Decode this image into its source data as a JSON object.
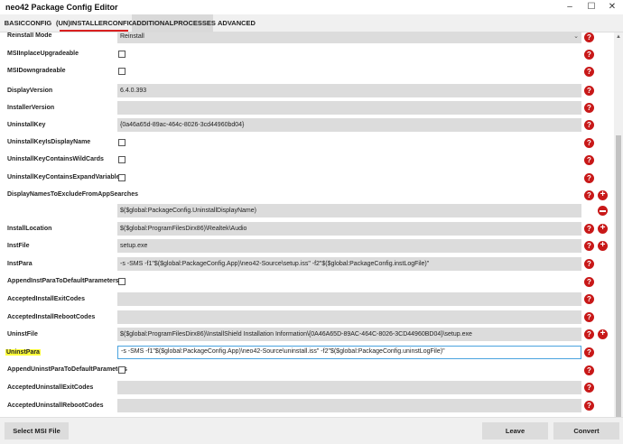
{
  "window": {
    "title": "neo42 Package Config Editor",
    "minimize": "–",
    "maximize": "☐",
    "close": "✕"
  },
  "tabs": [
    {
      "label": "BASICCONFIG"
    },
    {
      "label": "(UN)INSTALLERCONFIG"
    },
    {
      "label": "ADDITIONALPROCESSES"
    },
    {
      "label": "ADVANCED"
    }
  ],
  "icons": {
    "help": "?",
    "add": "+"
  },
  "fields": {
    "reinstall_mode": {
      "label": "Reinstall Mode",
      "value": "Reinstall"
    },
    "msi_inplace_upgradeable": {
      "label": "MSIInplaceUpgradeable"
    },
    "msi_downgradeable": {
      "label": "MSIDowngradeable"
    },
    "display_version": {
      "label": "DisplayVersion",
      "value": "6.4.0.393"
    },
    "installer_version": {
      "label": "InstallerVersion",
      "value": ""
    },
    "uninstall_key": {
      "label": "UninstallKey",
      "value": "{0a46a65d-89ac-464c-8026-3cd44960bd04}"
    },
    "uninstall_key_is_display_name": {
      "label": "UninstallKeyIsDisplayName"
    },
    "uninstall_key_contains_wildcards": {
      "label": "UninstallKeyContainsWildCards"
    },
    "uninstall_key_contains_expand_variables": {
      "label": "UninstallKeyContainsExpandVariables"
    },
    "display_names_to_exclude": {
      "label": "DisplayNamesToExcludeFromAppSearches",
      "value": "$($global:PackageConfig.UninstallDisplayName)"
    },
    "install_location": {
      "label": "InstallLocation",
      "value": "$($global:ProgramFilesDirx86)\\Realtek\\Audio"
    },
    "inst_file": {
      "label": "InstFile",
      "value": "setup.exe"
    },
    "inst_para": {
      "label": "InstPara",
      "value": "-s -SMS -f1\"$($global:PackageConfig.App)\\neo42-Source\\setup.iss\" -f2\"$($global:PackageConfig.instLogFile)\""
    },
    "append_inst_para": {
      "label": "AppendInstParaToDefaultParameters"
    },
    "accepted_install_exit_codes": {
      "label": "AcceptedInstallExitCodes",
      "value": ""
    },
    "accepted_install_reboot_codes": {
      "label": "AcceptedInstallRebootCodes",
      "value": ""
    },
    "uninst_file": {
      "label": "UninstFile",
      "value": "$($global:ProgramFilesDirx86)\\InstallShield Installation Information\\{0A46A65D-89AC-464C-8026-3CD44960BD04}\\setup.exe"
    },
    "uninst_para": {
      "label": "UninstPara",
      "value": "-s -SMS -f1\"$($global:PackageConfig.App)\\neo42-Source\\uninstall.iss\" -f2\"$($global:PackageConfig.uninstLogFile)\""
    },
    "append_uninst_para": {
      "label": "AppendUninstParaToDefaultParameters"
    },
    "accepted_uninstall_exit_codes": {
      "label": "AcceptedUninstallExitCodes",
      "value": ""
    },
    "accepted_uninstall_reboot_codes": {
      "label": "AcceptedUninstallRebootCodes",
      "value": ""
    }
  },
  "footer": {
    "select_msi": "Select MSI File",
    "leave": "Leave",
    "convert": "Convert"
  }
}
